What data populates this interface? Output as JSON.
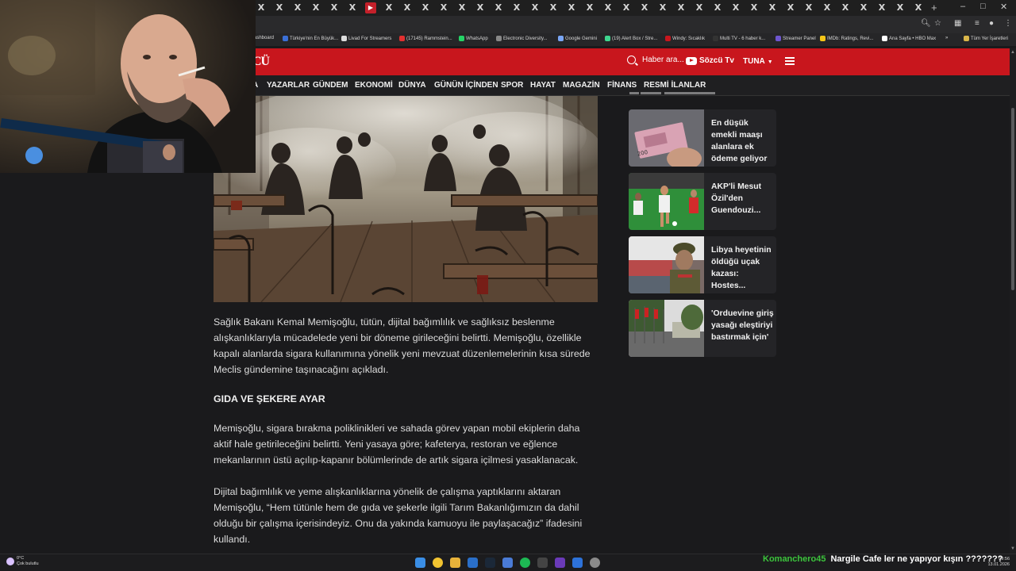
{
  "browser": {
    "tab_glyph": "X",
    "new_tab": "+",
    "window_controls": [
      "–",
      "□",
      "✕"
    ],
    "bookmarks": [
      {
        "label": "ashboard",
        "color": ""
      },
      {
        "label": "Türkiye'nin En Büyük...",
        "color": "#3b6fd6"
      },
      {
        "label": "Livad For Streamers",
        "color": "#dddddd"
      },
      {
        "label": "(17145) Rammstein...",
        "color": "#e23030"
      },
      {
        "label": "WhatsApp",
        "color": "#25d366"
      },
      {
        "label": "Electronic Diversity...",
        "color": "#888888"
      },
      {
        "label": "Google Gemini",
        "color": "#7aa6f5"
      },
      {
        "label": "(19) Alert Box / Stre...",
        "color": "#3fd68f"
      },
      {
        "label": "Windy: Sıcaklık",
        "color": "#c8161d"
      },
      {
        "label": "Multi TV - 6 haber k...",
        "color": "#333333"
      },
      {
        "label": "Streamer Panel",
        "color": "#6e56cf"
      },
      {
        "label": "IMDb: Ratings, Revi...",
        "color": "#f5c518"
      },
      {
        "label": "Ana Sayfa • HBO Max",
        "color": "#ffffff"
      },
      {
        "label": "»",
        "color": ""
      },
      {
        "label": "Tüm Yer İşaretleri",
        "color": "#d9b64a"
      }
    ]
  },
  "site": {
    "logo": "CÜ",
    "search_placeholder": "Haber ara...",
    "tv_label": "Sözcü Tv",
    "user_label": "TUNA",
    "nav_items": [
      "",
      "YAZARLAR",
      "GÜNDEM",
      "EKONOMİ",
      "DÜNYA",
      "GÜNÜN İÇİNDEN",
      "SPOR",
      "HAYAT",
      "MAGAZİN",
      "FİNANS",
      "RESMİ İLANLAR"
    ]
  },
  "article": {
    "paragraphs": [
      "Sağlık Bakanı Kemal Memişoğlu, tütün, dijital bağımlılık ve sağlıksız beslenme alışkanlıklarıyla mücadelede yeni bir döneme girileceğini belirtti. Memişoğlu, özellikle kapalı alanlarda sigara kullanımına yönelik yeni mevzuat düzenlemelerinin kısa sürede Meclis gündemine taşınacağını açıkladı."
    ],
    "subheading": "GIDA VE ŞEKERE AYAR",
    "paragraphs2": [
      "Memişoğlu, sigara bırakma poliklinikleri ve sahada görev yapan mobil ekiplerin daha aktif hale getirileceğini belirtti. Yeni yasaya göre; kafeterya, restoran ve eğlence mekanlarının üstü açılıp-kapanır bölümlerinde de artık sigara içilmesi yasaklanacak.",
      "Dijital bağımlılık ve yeme alışkanlıklarına yönelik de çalışma yaptıklarını aktaran Memişoğlu, “Hem tütünle hem de gıda ve şekerle ilgili Tarım Bakanlığımızın da dahil olduğu bir çalışma içerisindeyiz. Onu da yakında kamuoyu ile paylaşacağız” ifadesini kullandı."
    ]
  },
  "sidebar": {
    "news": [
      {
        "title": "En düşük emekli maaşı alanlara ek ödeme geliyor",
        "thumb": "money"
      },
      {
        "title": "AKP'li Mesut Özil'den Guendouzi...",
        "thumb": "football"
      },
      {
        "title": "Libya heyetinin öldüğü uçak kazası: Hostes...",
        "thumb": "general"
      },
      {
        "title": "'Orduevine giriş yasağı eleştiriyi bastırmak için'",
        "thumb": "building"
      }
    ]
  },
  "taskbar": {
    "temperature": "0°C",
    "weather": "Çok bulutlu",
    "time": "09:56",
    "date": "13.01.2026"
  },
  "chat": {
    "user": "Komanchero45",
    "message": "Nargile Cafe ler ne yapıyor kışın ???????"
  }
}
